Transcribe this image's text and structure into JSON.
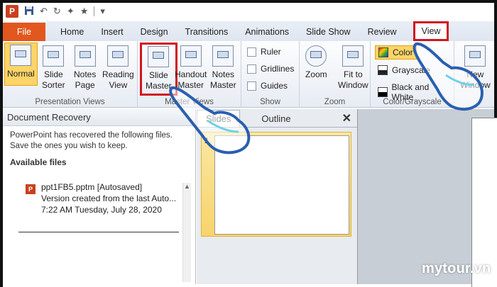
{
  "qat": {
    "app_icon": "P",
    "icons": [
      "save-icon",
      "undo-icon",
      "redo-icon",
      "format-painter-icon",
      "star-icon",
      "customize-icon"
    ]
  },
  "tabs": [
    {
      "label": "File"
    },
    {
      "label": "Home"
    },
    {
      "label": "Insert"
    },
    {
      "label": "Design"
    },
    {
      "label": "Transitions"
    },
    {
      "label": "Animations"
    },
    {
      "label": "Slide Show"
    },
    {
      "label": "Review"
    },
    {
      "label": "View"
    }
  ],
  "ribbon": {
    "presentation_views": {
      "label": "Presentation Views",
      "normal": "Normal",
      "slide_sorter": [
        "Slide",
        "Sorter"
      ],
      "notes_page": [
        "Notes",
        "Page"
      ],
      "reading_view": [
        "Reading",
        "View"
      ]
    },
    "master_views": {
      "label": "Master Views",
      "slide_master": [
        "Slide",
        "Master"
      ],
      "handout_master": [
        "Handout",
        "Master"
      ],
      "notes_master": [
        "Notes",
        "Master"
      ]
    },
    "show": {
      "label": "Show",
      "ruler": "Ruler",
      "gridlines": "Gridlines",
      "guides": "Guides"
    },
    "zoom": {
      "label": "Zoom",
      "zoom": "Zoom",
      "fit_to_window": [
        "Fit to",
        "Window"
      ]
    },
    "color_grayscale": {
      "label": "Color/Grayscale",
      "color": "Color",
      "grayscale": "Grayscale",
      "black_and_white": "Black and White"
    },
    "window": {
      "new_window": [
        "New",
        "Window"
      ]
    }
  },
  "recovery": {
    "title": "Document Recovery",
    "message": "PowerPoint has recovered the following files. Save the ones you wish to keep.",
    "available_label": "Available files",
    "file": {
      "name": "ppt1FB5.pptm  [Autosaved]",
      "desc": "Version created from the last Auto...",
      "time": "7:22 AM Tuesday, July 28, 2020"
    }
  },
  "slides_pane": {
    "tab_slides": "Slides",
    "tab_outline": "Outline",
    "close": "✕",
    "slide_number": "1"
  },
  "watermark": "mytour.vn",
  "colors": {
    "file_tab": "#e2571e",
    "highlight_box": "#d0161e",
    "selected": "#fcd467"
  }
}
